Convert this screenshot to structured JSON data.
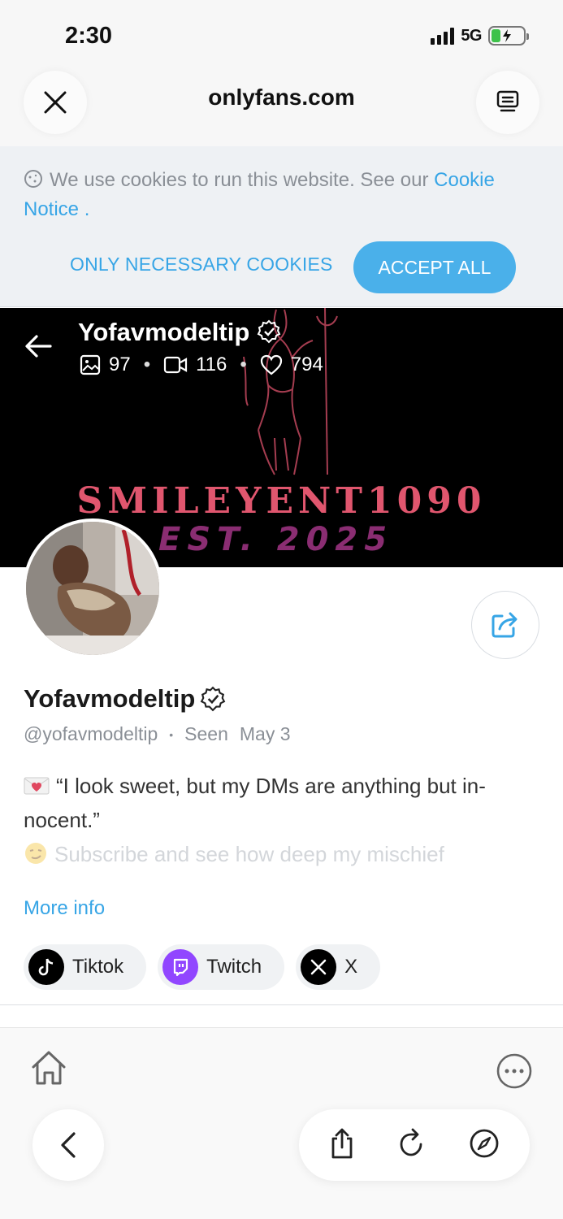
{
  "status_bar": {
    "time": "2:30",
    "network": "5G"
  },
  "browser": {
    "url": "onlyfans.com"
  },
  "cookie_banner": {
    "text": "We use cookies to run this website. See our ",
    "link_text": "Cookie Notice",
    "suffix": " .",
    "necessary_button": "ONLY NECESSARY COOKIES",
    "accept_button": "ACCEPT ALL"
  },
  "cover": {
    "name": "Yofavmodeltip",
    "photos_count": "97",
    "videos_count": "116",
    "likes_count": "794",
    "banner_title": "SMILEYENT1090",
    "banner_subtitle": "EST. 2025"
  },
  "profile": {
    "name": "Yofavmodeltip",
    "handle": "@yofavmodeltip",
    "seen_label": "Seen",
    "seen_date": "May 3",
    "bio_line1": "“I look sweet, but my DMs are anything but in-nocent.”",
    "bio_line2": "Subscribe and see how deep my mischief",
    "more_info": "More info"
  },
  "socials": [
    {
      "label": "Tiktok",
      "icon": "tiktok-icon",
      "color": "#000000"
    },
    {
      "label": "Twitch",
      "icon": "twitch-icon",
      "color": "#9146ff"
    },
    {
      "label": "X",
      "icon": "x-icon",
      "color": "#000000"
    }
  ],
  "colors": {
    "accent": "#37a5e6",
    "accept_button": "#4ab0ea",
    "banner_pink": "#e0566e",
    "banner_purple": "#8a2d72"
  }
}
